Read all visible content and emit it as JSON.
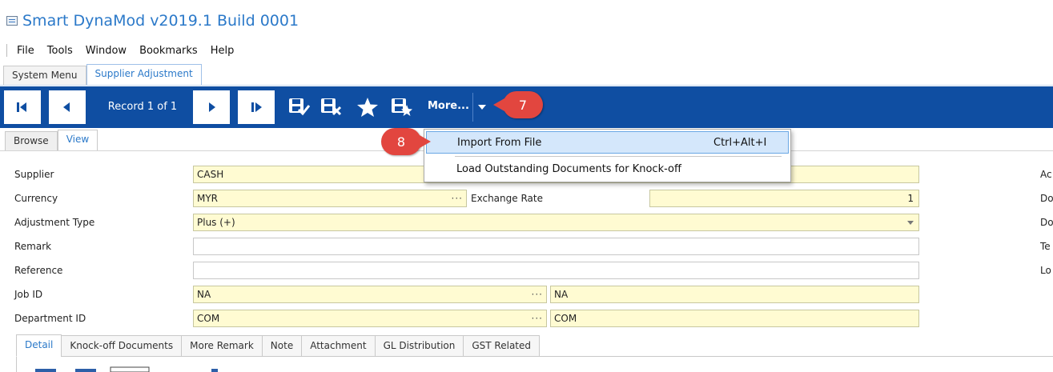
{
  "window": {
    "title": "Smart DynaMod v2019.1 Build 0001"
  },
  "menu": [
    "File",
    "Tools",
    "Window",
    "Bookmarks",
    "Help"
  ],
  "main_tabs": [
    "System Menu",
    "Supplier Adjustment"
  ],
  "toolbar": {
    "record_label": "Record 1 of 1",
    "more_label": "More...",
    "icons": [
      "first-record-icon",
      "previous-record-icon",
      "next-record-icon",
      "last-record-icon",
      "save-icon",
      "save-close-icon",
      "bookmark-star-icon",
      "bookmark-save-icon",
      "chevron-down-icon"
    ]
  },
  "callouts": [
    "7",
    "8"
  ],
  "sub_tabs": [
    "Browse",
    "View"
  ],
  "dropdown_menu": {
    "items": [
      {
        "label": "Import From File",
        "shortcut": "Ctrl+Alt+I"
      },
      {
        "label": "Load Outstanding Documents for Knock-off",
        "shortcut": ""
      }
    ]
  },
  "form": {
    "supplier": {
      "label": "Supplier",
      "value": "CASH"
    },
    "currency": {
      "label": "Currency",
      "value": "MYR"
    },
    "exchange_rate": {
      "label": "Exchange Rate",
      "value": "1"
    },
    "adjustment_type": {
      "label": "Adjustment Type",
      "value": "Plus (+)"
    },
    "remark": {
      "label": "Remark",
      "value": ""
    },
    "reference": {
      "label": "Reference",
      "value": ""
    },
    "job_id": {
      "label": "Job ID",
      "value": "NA",
      "description": "NA"
    },
    "department_id": {
      "label": "Department ID",
      "value": "COM",
      "description": "COM"
    }
  },
  "right_labels": [
    "Ac",
    "Do",
    "Do",
    "Te",
    "Lo"
  ],
  "bottom_tabs": [
    "Detail",
    "Knock-off Documents",
    "More Remark",
    "Note",
    "Attachment",
    "GL Distribution",
    "GST Related"
  ],
  "colors": {
    "toolbar_bg": "#0f4ea2",
    "accent": "#2b79c9",
    "field_bg": "#fffbd2",
    "callout": "#e2463f",
    "menu_highlight": "#d4e7fb"
  }
}
